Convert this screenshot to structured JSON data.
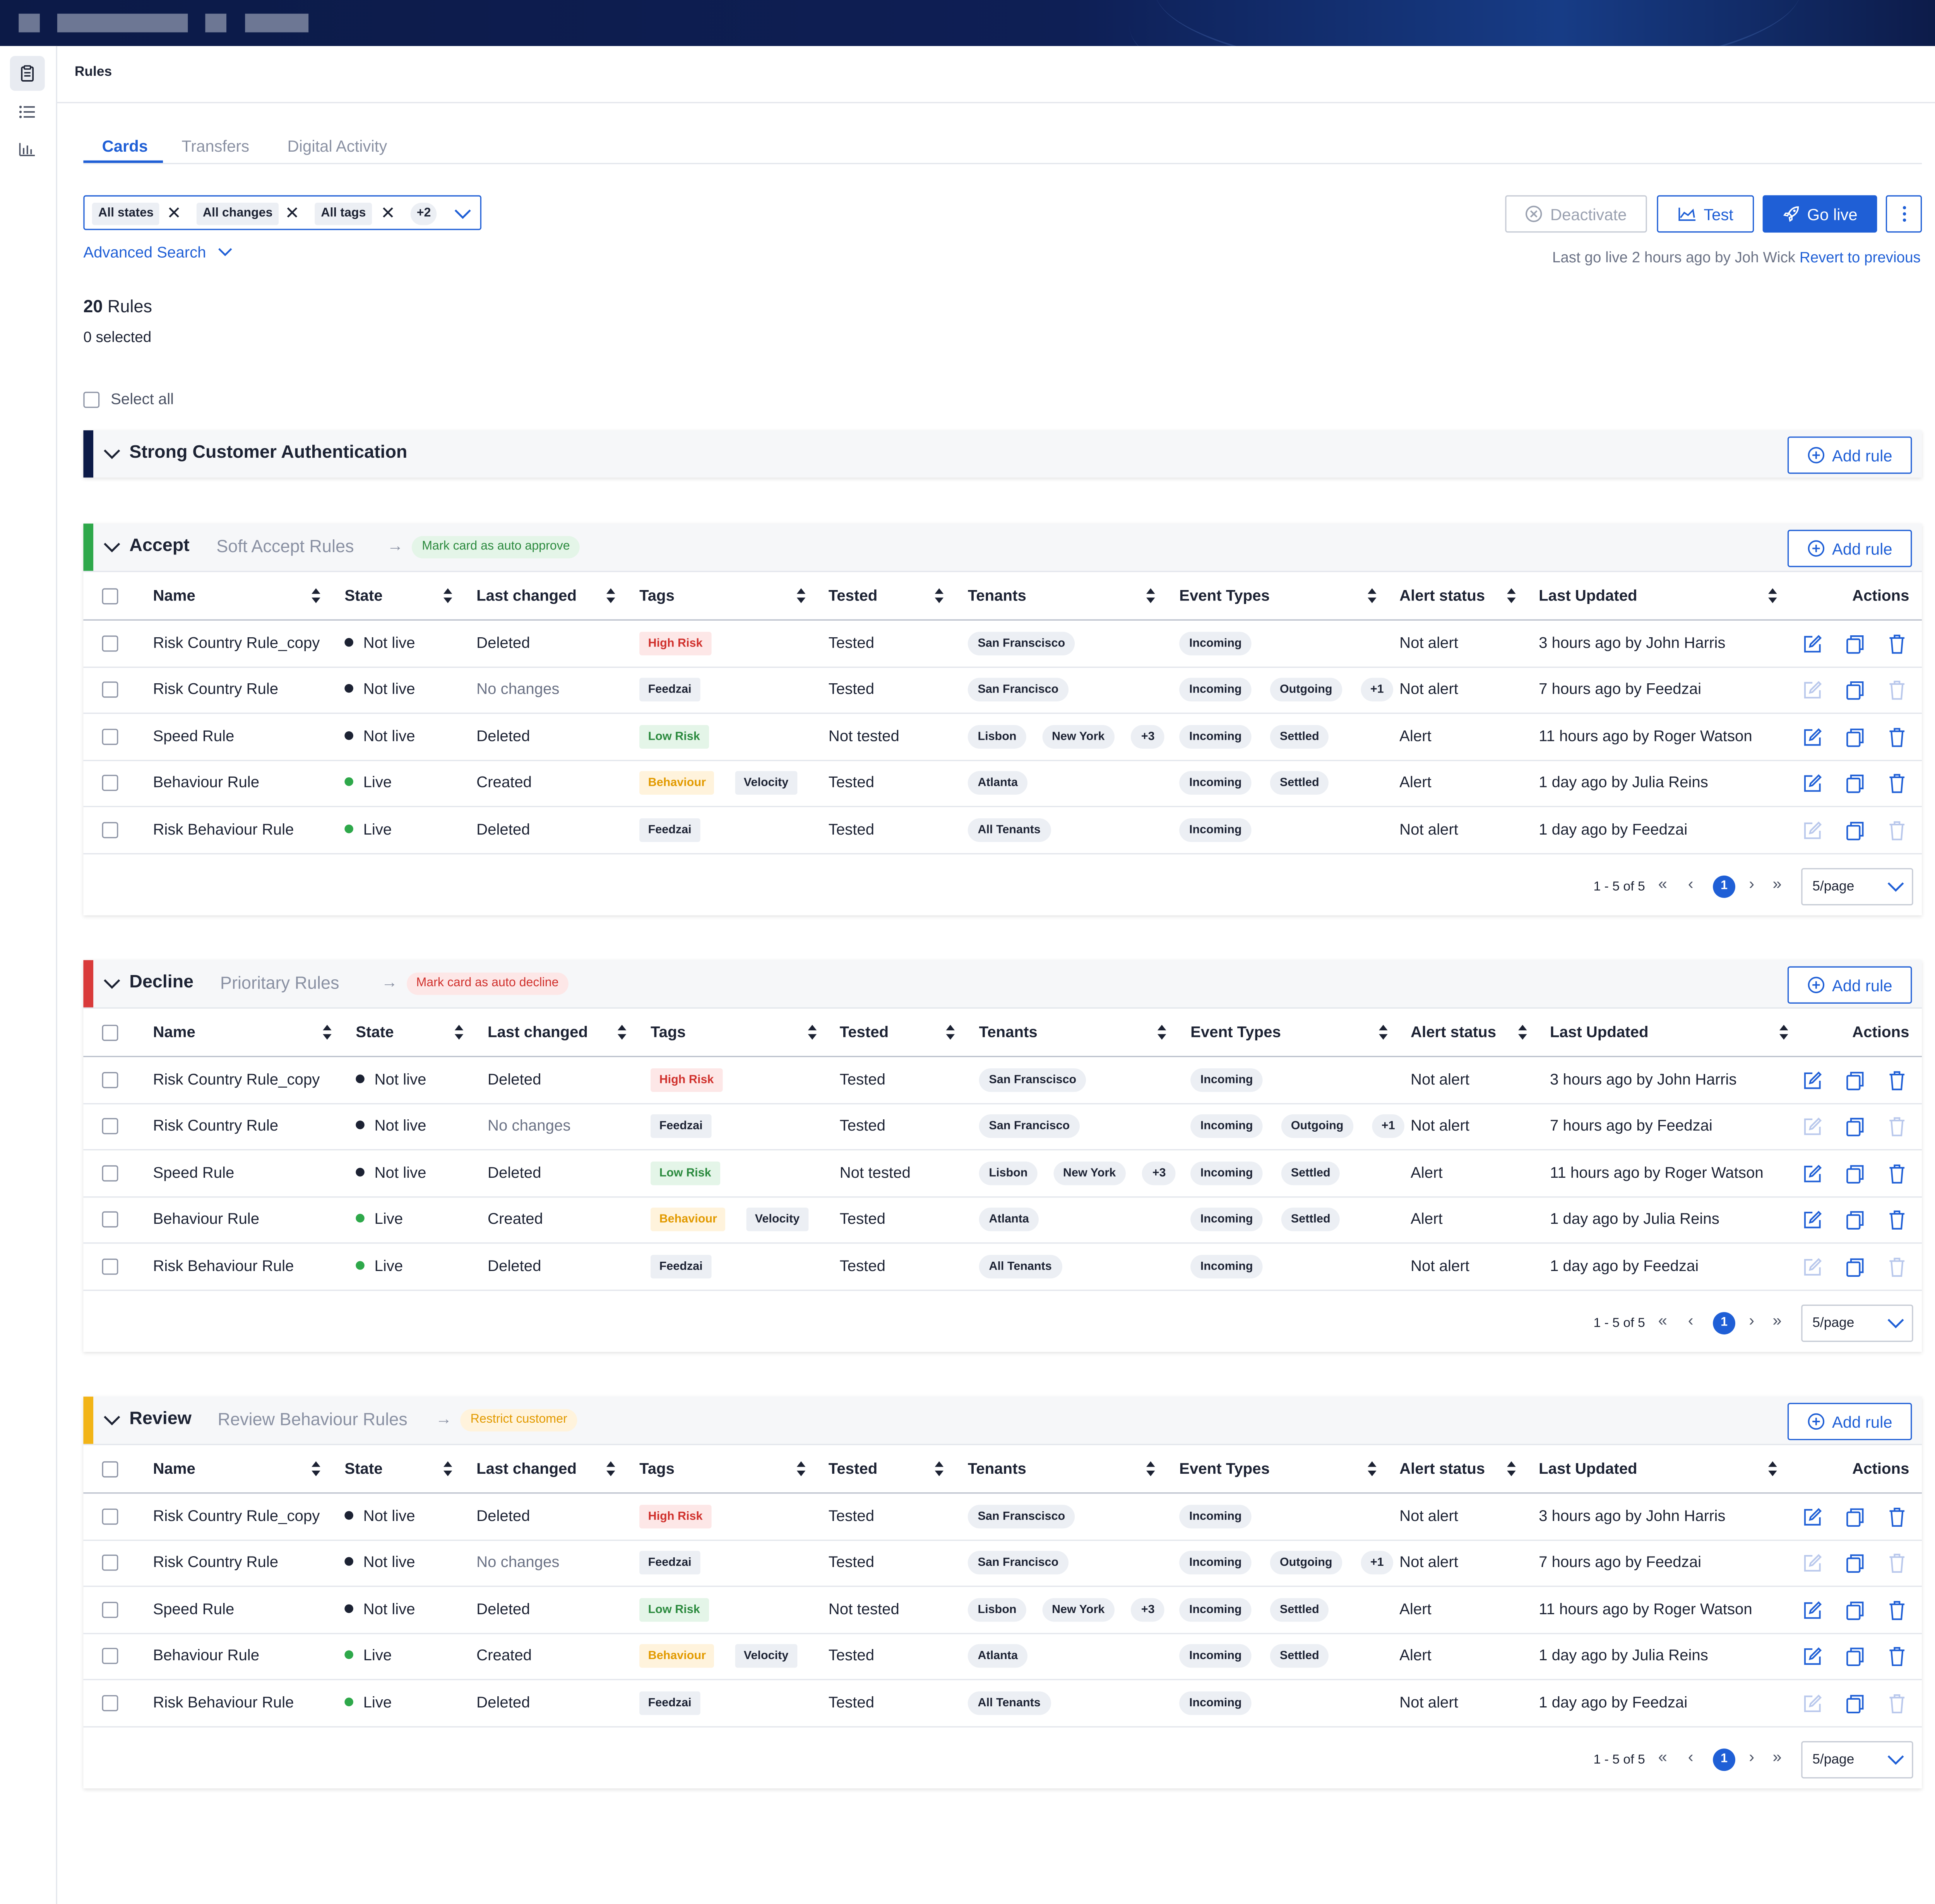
{
  "page": {
    "title": "Rules"
  },
  "tabs": [
    "Cards",
    "Transfers",
    "Digital Activity"
  ],
  "filters": {
    "chips": [
      "All states",
      "All changes",
      "All tags"
    ],
    "more": "+2",
    "advanced_search": "Advanced Search"
  },
  "toolbar": {
    "deactivate": "Deactivate",
    "test": "Test",
    "go_live": "Go live",
    "last_go_live": "Last go live 2 hours ago by Joh Wick",
    "revert": "Revert to previous"
  },
  "summary": {
    "count": "20",
    "count_label": "Rules",
    "selected": "0 selected",
    "select_all": "Select all"
  },
  "sca": {
    "title": "Strong Customer Authentication",
    "add_rule": "Add rule"
  },
  "columns": [
    "Name",
    "State",
    "Last changed",
    "Tags",
    "Tested",
    "Tenants",
    "Event Types",
    "Alert status",
    "Last Updated",
    "Actions"
  ],
  "groups": [
    {
      "title": "Accept",
      "subtitle": "Soft Accept Rules",
      "badge": "Mark card as auto approve",
      "add_rule": "Add rule",
      "color": "#2ea84a",
      "pager": {
        "info": "1 - 5 of 5",
        "page": "1",
        "per_page": "5/page"
      },
      "rows": [
        {
          "name": "Risk Country Rule_copy",
          "state": "Not live",
          "state_color": "#1c2233",
          "last_changed": "Deleted",
          "tags": [
            {
              "t": "High Risk",
              "k": "red"
            }
          ],
          "tested": "Tested",
          "tenants": [
            "San Franscisco"
          ],
          "events": [
            "Incoming"
          ],
          "alert": "Not alert",
          "updated": "3 hours ago by John Harris",
          "muted": false
        },
        {
          "name": "Risk Country Rule",
          "state": "Not live",
          "state_color": "#1c2233",
          "last_changed": "No changes",
          "tags": [
            {
              "t": "Feedzai",
              "k": "grey"
            }
          ],
          "tested": "Tested",
          "tenants": [
            "San Francisco"
          ],
          "events": [
            "Incoming",
            "Outgoing",
            "+1"
          ],
          "alert": "Not alert",
          "updated": "7 hours ago by Feedzai",
          "muted": true
        },
        {
          "name": "Speed Rule",
          "state": "Not live",
          "state_color": "#1c2233",
          "last_changed": "Deleted",
          "tags": [
            {
              "t": "Low Risk",
              "k": "green"
            }
          ],
          "tested": "Not tested",
          "tenants": [
            "Lisbon",
            "New York",
            "+3"
          ],
          "events": [
            "Incoming",
            "Settled"
          ],
          "alert": "Alert",
          "updated": "11 hours ago by Roger Watson",
          "muted": false
        },
        {
          "name": "Behaviour Rule",
          "state": "Live",
          "state_color": "#2ea84a",
          "last_changed": "Created",
          "tags": [
            {
              "t": "Behaviour",
              "k": "orange"
            },
            {
              "t": "Velocity",
              "k": "grey"
            }
          ],
          "tested": "Tested",
          "tenants": [
            "Atlanta"
          ],
          "events": [
            "Incoming",
            "Settled"
          ],
          "alert": "Alert",
          "updated": "1 day ago by Julia Reins",
          "muted": false
        },
        {
          "name": "Risk Behaviour Rule",
          "state": "Live",
          "state_color": "#2ea84a",
          "last_changed": "Deleted",
          "tags": [
            {
              "t": "Feedzai",
              "k": "grey"
            }
          ],
          "tested": "Tested",
          "tenants": [
            "All Tenants"
          ],
          "events": [
            "Incoming"
          ],
          "alert": "Not alert",
          "updated": "1 day ago by Feedzai",
          "muted": true
        }
      ]
    },
    {
      "title": "Decline",
      "subtitle": "Prioritary Rules",
      "badge": "Mark card as auto decline",
      "add_rule": "Add rule",
      "color": "#d93a3a",
      "pager": {
        "info": "1 - 5 of 5",
        "page": "1",
        "per_page": "5/page"
      },
      "rows": [
        {
          "name": "Risk Country Rule_copy",
          "state": "Not live",
          "state_color": "#1c2233",
          "last_changed": "Deleted",
          "tags": [
            {
              "t": "High Risk",
              "k": "red"
            }
          ],
          "tested": "Tested",
          "tenants": [
            "San Franscisco"
          ],
          "events": [
            "Incoming"
          ],
          "alert": "Not alert",
          "updated": "3 hours ago by John Harris",
          "muted": false
        },
        {
          "name": "Risk Country Rule",
          "state": "Not live",
          "state_color": "#1c2233",
          "last_changed": "No changes",
          "tags": [
            {
              "t": "Feedzai",
              "k": "grey"
            }
          ],
          "tested": "Tested",
          "tenants": [
            "San Francisco"
          ],
          "events": [
            "Incoming",
            "Outgoing",
            "+1"
          ],
          "alert": "Not alert",
          "updated": "7 hours ago by Feedzai",
          "muted": true
        },
        {
          "name": "Speed Rule",
          "state": "Not live",
          "state_color": "#1c2233",
          "last_changed": "Deleted",
          "tags": [
            {
              "t": "Low Risk",
              "k": "green"
            }
          ],
          "tested": "Not tested",
          "tenants": [
            "Lisbon",
            "New York",
            "+3"
          ],
          "events": [
            "Incoming",
            "Settled"
          ],
          "alert": "Alert",
          "updated": "11 hours ago by Roger Watson",
          "muted": false
        },
        {
          "name": "Behaviour Rule",
          "state": "Live",
          "state_color": "#2ea84a",
          "last_changed": "Created",
          "tags": [
            {
              "t": "Behaviour",
              "k": "orange"
            },
            {
              "t": "Velocity",
              "k": "grey"
            }
          ],
          "tested": "Tested",
          "tenants": [
            "Atlanta"
          ],
          "events": [
            "Incoming",
            "Settled"
          ],
          "alert": "Alert",
          "updated": "1 day ago by Julia Reins",
          "muted": false
        },
        {
          "name": "Risk Behaviour Rule",
          "state": "Live",
          "state_color": "#2ea84a",
          "last_changed": "Deleted",
          "tags": [
            {
              "t": "Feedzai",
              "k": "grey"
            }
          ],
          "tested": "Tested",
          "tenants": [
            "All Tenants"
          ],
          "events": [
            "Incoming"
          ],
          "alert": "Not alert",
          "updated": "1 day ago by Feedzai",
          "muted": true
        }
      ]
    },
    {
      "title": "Review",
      "subtitle": "Review Behaviour Rules",
      "badge": "Restrict customer",
      "add_rule": "Add rule",
      "color": "#f2b417",
      "pager": {
        "info": "1 - 5 of 5",
        "page": "1",
        "per_page": "5/page"
      },
      "rows": [
        {
          "name": "Risk Country Rule_copy",
          "state": "Not live",
          "state_color": "#1c2233",
          "last_changed": "Deleted",
          "tags": [
            {
              "t": "High Risk",
              "k": "red"
            }
          ],
          "tested": "Tested",
          "tenants": [
            "San Franscisco"
          ],
          "events": [
            "Incoming"
          ],
          "alert": "Not alert",
          "updated": "3 hours ago by John Harris",
          "muted": false
        },
        {
          "name": "Risk Country Rule",
          "state": "Not live",
          "state_color": "#1c2233",
          "last_changed": "No changes",
          "tags": [
            {
              "t": "Feedzai",
              "k": "grey"
            }
          ],
          "tested": "Tested",
          "tenants": [
            "San Francisco"
          ],
          "events": [
            "Incoming",
            "Outgoing",
            "+1"
          ],
          "alert": "Not alert",
          "updated": "7 hours ago by Feedzai",
          "muted": true
        },
        {
          "name": "Speed Rule",
          "state": "Not live",
          "state_color": "#1c2233",
          "last_changed": "Deleted",
          "tags": [
            {
              "t": "Low Risk",
              "k": "green"
            }
          ],
          "tested": "Not tested",
          "tenants": [
            "Lisbon",
            "New York",
            "+3"
          ],
          "events": [
            "Incoming",
            "Settled"
          ],
          "alert": "Alert",
          "updated": "11 hours ago by Roger Watson",
          "muted": false
        },
        {
          "name": "Behaviour Rule",
          "state": "Live",
          "state_color": "#2ea84a",
          "last_changed": "Created",
          "tags": [
            {
              "t": "Behaviour",
              "k": "orange"
            },
            {
              "t": "Velocity",
              "k": "grey"
            }
          ],
          "tested": "Tested",
          "tenants": [
            "Atlanta"
          ],
          "events": [
            "Incoming",
            "Settled"
          ],
          "alert": "Alert",
          "updated": "1 day ago by Julia Reins",
          "muted": false
        },
        {
          "name": "Risk Behaviour Rule",
          "state": "Live",
          "state_color": "#2ea84a",
          "last_changed": "Deleted",
          "tags": [
            {
              "t": "Feedzai",
              "k": "grey"
            }
          ],
          "tested": "Tested",
          "tenants": [
            "All Tenants"
          ],
          "events": [
            "Incoming"
          ],
          "alert": "Not alert",
          "updated": "1 day ago by Feedzai",
          "muted": true
        }
      ]
    }
  ],
  "icons": {
    "sidebar": [
      "clipboard-icon",
      "list-icon",
      "bar-chart-icon"
    ]
  }
}
